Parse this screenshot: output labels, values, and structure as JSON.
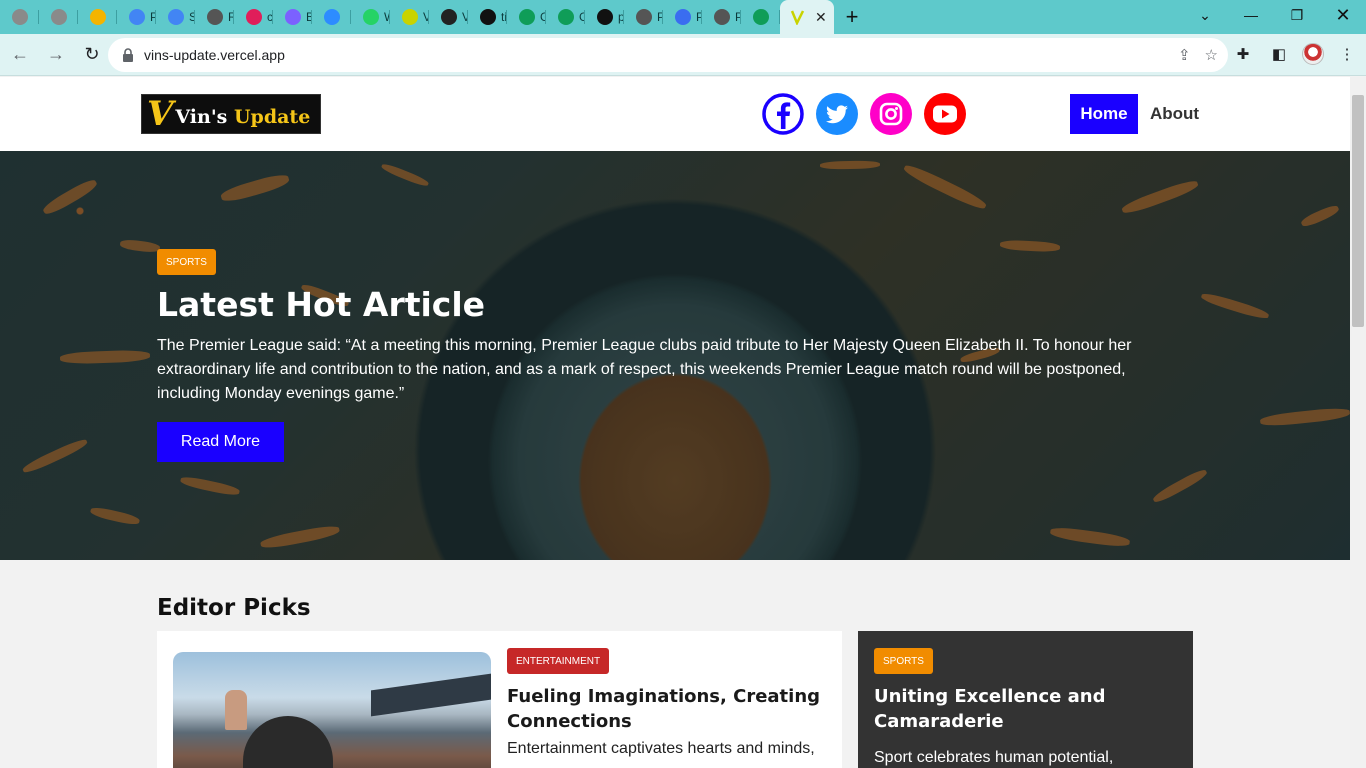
{
  "browser": {
    "tabs": [
      {
        "label": "",
        "color": "#8a8a8a"
      },
      {
        "label": "",
        "color": "#8a8a8a"
      },
      {
        "label": "",
        "color": "#f4b400"
      },
      {
        "label": "Pa",
        "color": "#4285f4"
      },
      {
        "label": "Ste",
        "color": "#4285f4"
      },
      {
        "label": "Re",
        "color": "#555555"
      },
      {
        "label": "col",
        "color": "#e01e5a"
      },
      {
        "label": "Ba",
        "color": "#7b61ff"
      },
      {
        "label": "",
        "color": "#2d8cff"
      },
      {
        "label": "Wh",
        "color": "#25d366"
      },
      {
        "label": "Vin",
        "color": "#c9d300"
      },
      {
        "label": "Vin",
        "color": "#222222"
      },
      {
        "label": "tiic",
        "color": "#111111"
      },
      {
        "label": "Go",
        "color": "#0f9d58"
      },
      {
        "label": "Go",
        "color": "#0f9d58"
      },
      {
        "label": "pe",
        "color": "#111111"
      },
      {
        "label": "Pre",
        "color": "#555555"
      },
      {
        "label": "Pre",
        "color": "#3a6df0"
      },
      {
        "label": "Pre",
        "color": "#555555"
      },
      {
        "label": "",
        "color": "#0f9d58"
      }
    ],
    "active_tab_close": "✕",
    "new_tab": "+",
    "url": "vins-update.vercel.app"
  },
  "site": {
    "logo_v": "V",
    "logo_text_1": "Vin's",
    "logo_text_2": "Update",
    "socials": [
      "facebook-icon",
      "twitter-icon",
      "instagram-icon",
      "youtube-icon"
    ],
    "nav": {
      "home": "Home",
      "about": "About"
    }
  },
  "hero": {
    "badge": "SPORTS",
    "title": "Latest Hot Article",
    "text": "The Premier League said: “At a meeting this morning, Premier League clubs paid tribute to Her Majesty Queen Elizabeth II. To honour her extraordinary life and contribution to the nation, and as a mark of respect, this weekends Premier League match round will be postponed, including Monday evenings game.”",
    "button": "Read More"
  },
  "editor_picks": {
    "heading": "Editor Picks",
    "main_card": {
      "badge": "ENTERTAINMENT",
      "title": "Fueling Imaginations, Creating Connections",
      "text": "Entertainment captivates hearts and minds,"
    },
    "side_card": {
      "badge": "SPORTS",
      "title": "Uniting Excellence and Camaraderie",
      "text": "Sport celebrates human potential,"
    }
  },
  "colors": {
    "accent": "#1a00ff",
    "sports_badge": "#f18c00",
    "entertainment_badge": "#c62828",
    "tabbar": "#5ec9cb"
  }
}
